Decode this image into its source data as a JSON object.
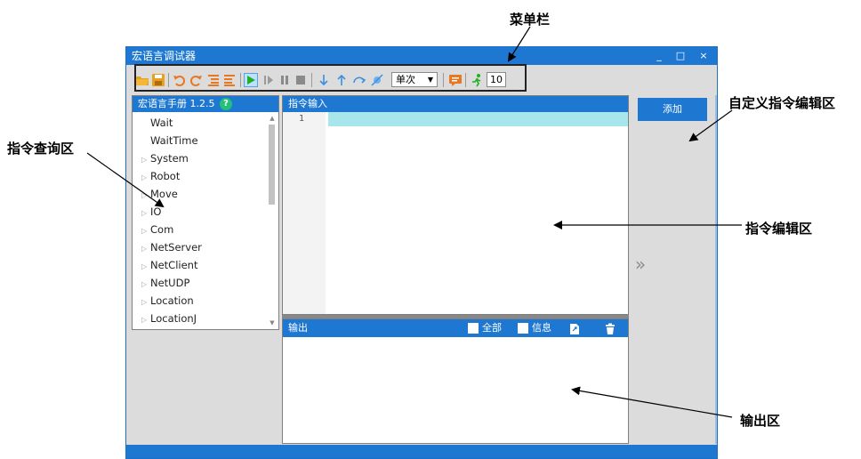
{
  "window": {
    "title": "宏语言调试器",
    "controls": [
      "_",
      "□",
      "×"
    ]
  },
  "toolbar": {
    "icons": [
      "open-folder-icon",
      "save-icon",
      "undo-icon",
      "redo-icon",
      "indent-icon",
      "outdent-icon",
      "run-icon",
      "step-icon",
      "pause-icon",
      "stop-icon",
      "step-into-icon",
      "step-out-icon",
      "step-over-icon",
      "clear-breakpoints-icon",
      "note-icon",
      "runner-icon"
    ],
    "mode_select": "单次",
    "speed_value": "10"
  },
  "manual": {
    "title": "宏语言手册 1.2.5",
    "help_icon": "?",
    "items": [
      {
        "label": "Wait",
        "expandable": false
      },
      {
        "label": "WaitTime",
        "expandable": false
      },
      {
        "label": "System",
        "expandable": true
      },
      {
        "label": "Robot",
        "expandable": true
      },
      {
        "label": "Move",
        "expandable": true
      },
      {
        "label": "IO",
        "expandable": true
      },
      {
        "label": "Com",
        "expandable": true
      },
      {
        "label": "NetServer",
        "expandable": true
      },
      {
        "label": "NetClient",
        "expandable": true
      },
      {
        "label": "NetUDP",
        "expandable": true
      },
      {
        "label": "Location",
        "expandable": true
      },
      {
        "label": "LocationJ",
        "expandable": true
      }
    ]
  },
  "editor": {
    "title": "指令输入",
    "line_numbers": [
      "1"
    ]
  },
  "output": {
    "title": "输出",
    "filters": [
      {
        "label": "全部",
        "checked": false
      },
      {
        "label": "信息",
        "checked": false
      }
    ]
  },
  "custom_panel": {
    "add_label": "添加",
    "expand_glyph": "»"
  },
  "annotations": {
    "menu_bar": "菜单栏",
    "query_area": "指令查询区",
    "custom_area": "自定义指令编辑区",
    "edit_area": "指令编辑区",
    "output_area": "输出区"
  },
  "colors": {
    "accent": "#1e78d2",
    "window_bg": "#dcdcdc",
    "current_line": "#a7e6ea",
    "run_green": "#20b020",
    "icon_orange": "#e87722",
    "step_blue": "#3b8fe0"
  }
}
